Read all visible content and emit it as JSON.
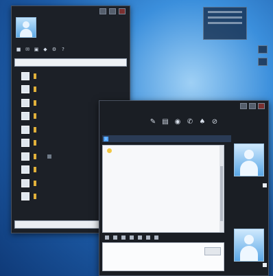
{
  "contact_list": {
    "profile": {
      "name": "",
      "status": ""
    },
    "toolbar_icons": [
      "contacts-icon",
      "mail-icon",
      "share-icon",
      "games-icon",
      "settings-icon",
      "help-icon"
    ],
    "search": {
      "placeholder": ""
    },
    "contacts": [
      {
        "name": "",
        "status": "online"
      },
      {
        "name": "",
        "status": "online"
      },
      {
        "name": "",
        "status": "away"
      },
      {
        "name": "",
        "status": "online"
      },
      {
        "name": "",
        "status": "away"
      },
      {
        "name": "",
        "status": "online"
      },
      {
        "name": "",
        "status": "online"
      },
      {
        "name": "",
        "status": "away"
      },
      {
        "name": "",
        "status": "online"
      },
      {
        "name": "",
        "status": "online"
      }
    ],
    "groups": [
      "",
      ""
    ],
    "footer_input": {
      "placeholder": ""
    }
  },
  "chat": {
    "title": "",
    "toolbar_icons": [
      "invite-icon",
      "share-files-icon",
      "video-icon",
      "call-icon",
      "games-icon",
      "block-icon"
    ],
    "info_bar": "",
    "messages": [
      {
        "sender": "",
        "text": ""
      },
      {
        "sender": "",
        "text": ""
      },
      {
        "sender": "",
        "text": ""
      },
      {
        "sender": "",
        "text": ""
      }
    ],
    "send_label": ""
  },
  "colors": {
    "window_bg": "#1c2027",
    "accent": "#4ea3ff",
    "status_online": "#e1b13a"
  }
}
